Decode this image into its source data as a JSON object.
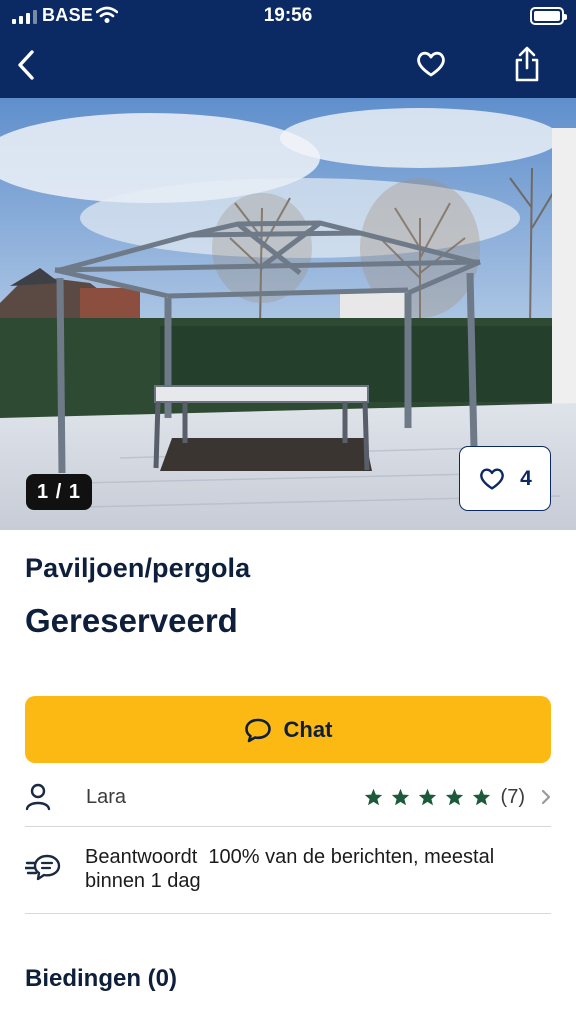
{
  "status_bar": {
    "carrier": "BASE",
    "time": "19:56"
  },
  "nav": {
    "back_icon": "chevron-left-icon",
    "favorite_icon": "heart-outline-icon",
    "share_icon": "share-icon"
  },
  "gallery": {
    "counter": "1 / 1",
    "like_count": "4"
  },
  "listing": {
    "category": "Paviljoen/pergola",
    "status": "Gereserveerd"
  },
  "actions": {
    "chat_label": "Chat"
  },
  "seller": {
    "name": "Lara",
    "rating_stars": 5,
    "reviews": "(7)"
  },
  "response": {
    "text_line1": "Beantwoordt  100% van de berichten, meestal",
    "text_line2": "binnen 1 dag"
  },
  "bids": {
    "title": "Biedingen (0)"
  },
  "colors": {
    "header": "#0b2a63",
    "accent_yellow": "#fdb913",
    "star_green": "#1c5a3b"
  }
}
